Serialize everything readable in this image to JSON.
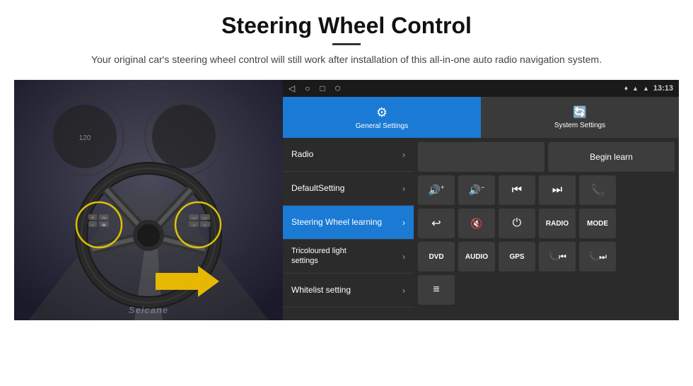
{
  "header": {
    "title": "Steering Wheel Control",
    "subtitle": "Your original car's steering wheel control will still work after installation of this all-in-one auto radio navigation system."
  },
  "status_bar": {
    "time": "13:13",
    "nav_icons": [
      "◁",
      "○",
      "□",
      "⬡"
    ],
    "signal_icons": [
      "▲",
      "▲",
      "🔋"
    ]
  },
  "tabs": [
    {
      "label": "General Settings",
      "active": true,
      "icon": "⚙"
    },
    {
      "label": "System Settings",
      "active": false,
      "icon": "🔄"
    }
  ],
  "menu": [
    {
      "label": "Radio",
      "active": false
    },
    {
      "label": "DefaultSetting",
      "active": false
    },
    {
      "label": "Steering Wheel learning",
      "active": true
    },
    {
      "label": "Tricoloured light settings",
      "active": false
    },
    {
      "label": "Whitelist setting",
      "active": false
    }
  ],
  "controls": {
    "row1": {
      "empty_label": "",
      "begin_learn": "Begin learn"
    },
    "row2": {
      "buttons": [
        "🔊+",
        "🔊−",
        "⏮",
        "⏭",
        "📞"
      ]
    },
    "row3": {
      "buttons": [
        "↩",
        "🔇",
        "⏻",
        "RADIO",
        "MODE"
      ]
    },
    "row4": {
      "buttons": [
        "DVD",
        "AUDIO",
        "GPS",
        "📞⏮",
        "📞⏭"
      ]
    },
    "row5": {
      "buttons": [
        "≡"
      ]
    }
  },
  "watermark": "Seicane"
}
